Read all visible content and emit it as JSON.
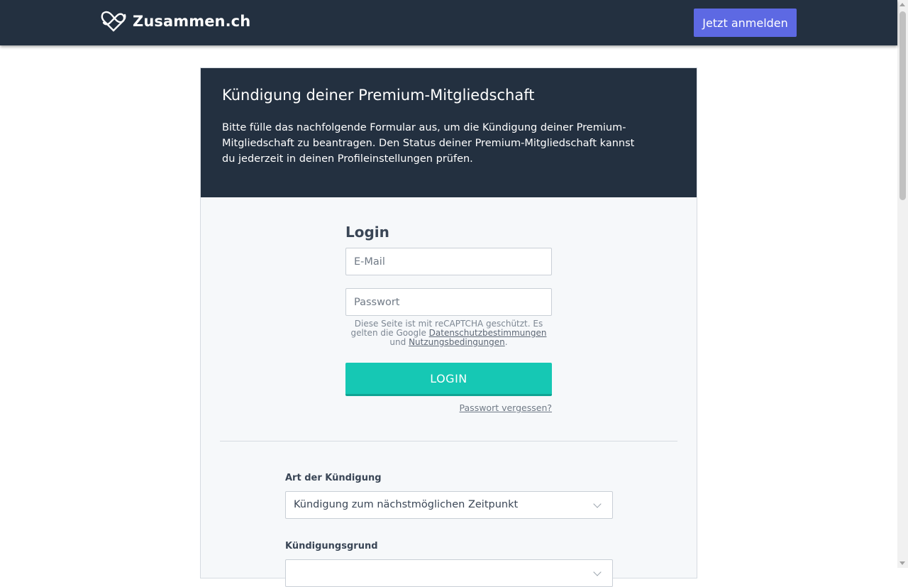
{
  "header": {
    "logo_text": "Zusammen.ch",
    "signup_label": "Jetzt anmelden"
  },
  "intro": {
    "title": "Kündigung deiner Premium-Mitgliedschaft",
    "description": "Bitte fülle das nachfolgende Formular aus, um die Kündigung deiner Premium-Mitgliedschaft zu beantragen. Den Status deiner Premium-Mitgliedschaft kannst du jederzeit in deinen Profileinstellungen prüfen."
  },
  "login": {
    "title": "Login",
    "email_placeholder": "E-Mail",
    "password_placeholder": "Passwort",
    "recaptcha_before": "Diese Seite ist mit reCAPTCHA geschützt. Es gelten die Google ",
    "privacy_link": "Datenschutzbestimmungen",
    "recaptcha_and": " und ",
    "terms_link": "Nutzungsbedingungen",
    "recaptcha_end": ".",
    "button_label": "LOGIN",
    "forgot_label": "Passwort vergessen?"
  },
  "cancellation": {
    "type_label": "Art der Kündigung",
    "type_value": "Kündigung zum nächstmöglichen Zeitpunkt",
    "reason_label": "Kündigungsgrund",
    "reason_value": ""
  },
  "colors": {
    "header_bg": "#233040",
    "accent_primary": "#5d69e3",
    "login_button": "#16c8b4"
  }
}
